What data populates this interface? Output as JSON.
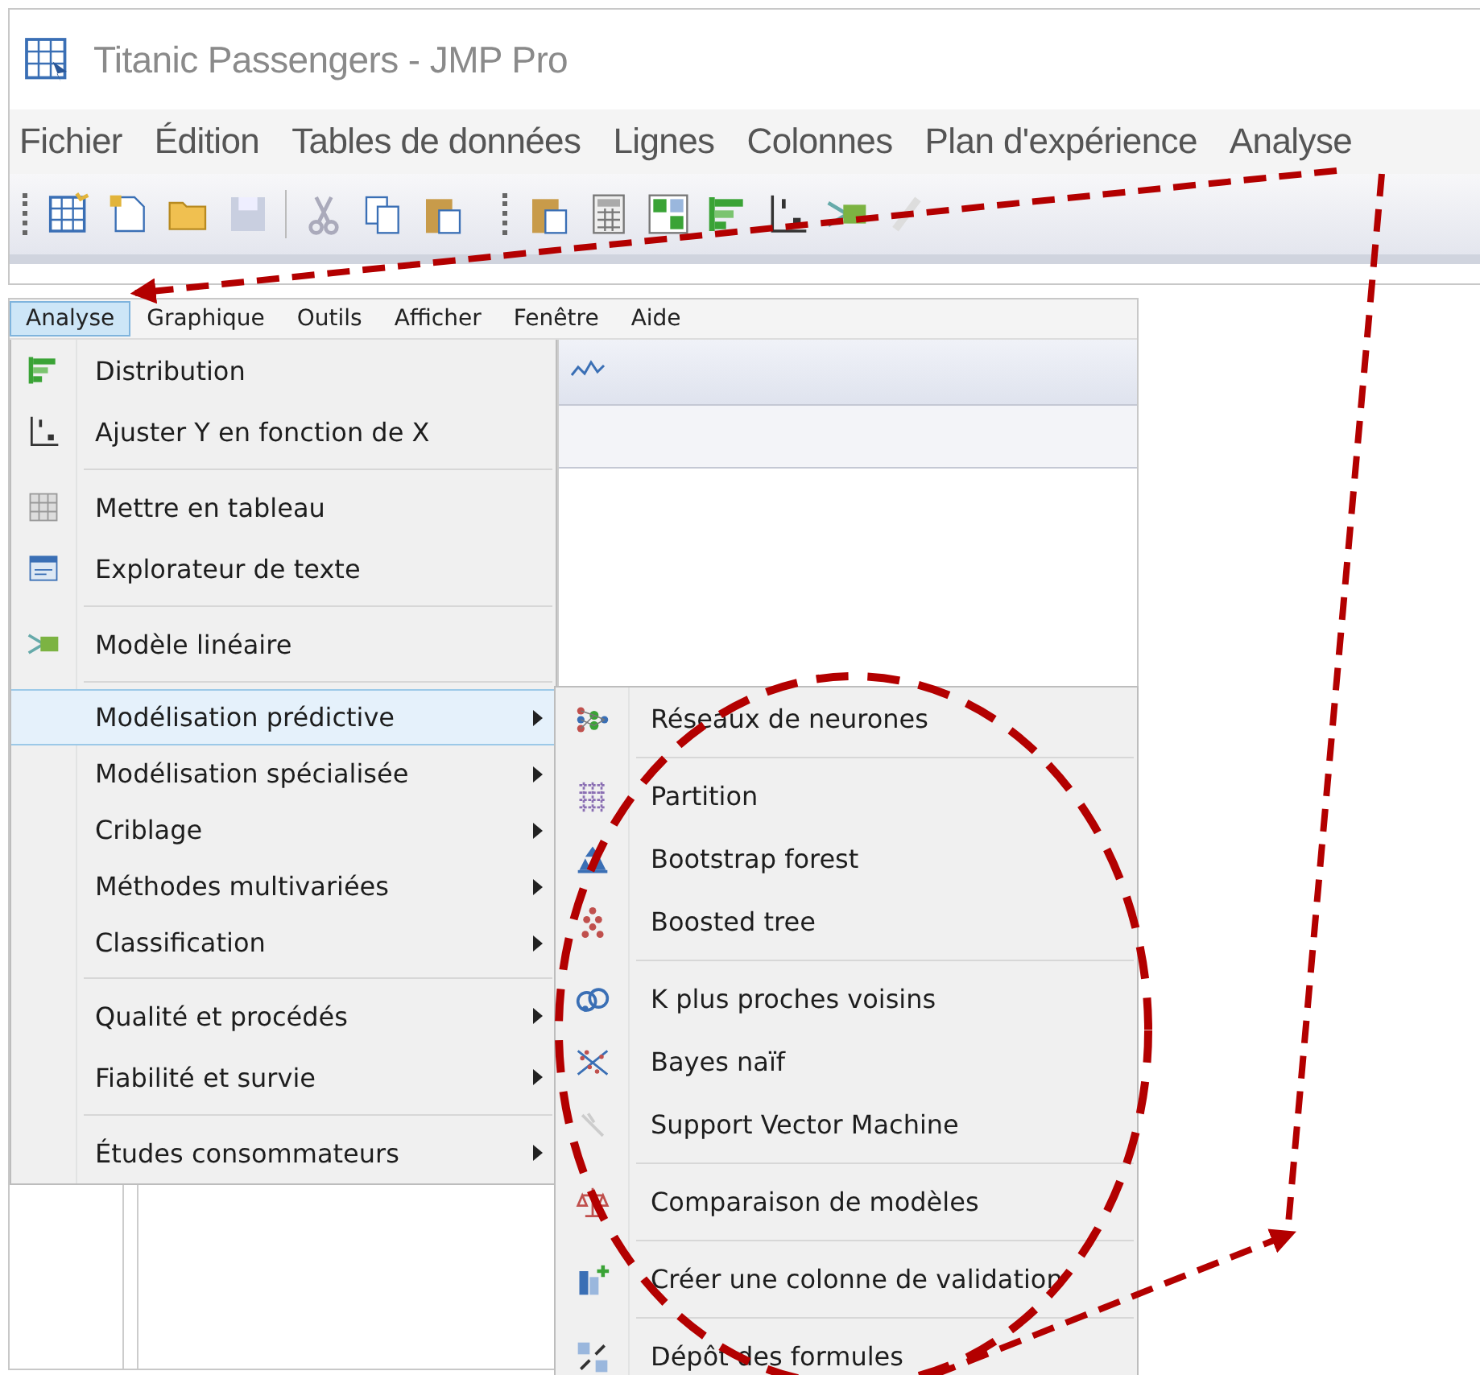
{
  "window": {
    "title": "Titanic Passengers - JMP Pro"
  },
  "menu_bar": [
    {
      "label": "Fichier"
    },
    {
      "label": "Édition"
    },
    {
      "label": "Tables de données"
    },
    {
      "label": "Lignes"
    },
    {
      "label": "Colonnes"
    },
    {
      "label": "Plan d'expérience"
    },
    {
      "label": "Analyse"
    }
  ],
  "data_window": {
    "menu_bar": [
      {
        "label": "Analyse",
        "selected": true
      },
      {
        "label": "Graphique",
        "selected": false
      },
      {
        "label": "Outils",
        "selected": false
      },
      {
        "label": "Afficher",
        "selected": false
      },
      {
        "label": "Fenêtre",
        "selected": false
      },
      {
        "label": "Aide",
        "selected": false
      }
    ]
  },
  "analyse_menu": {
    "groups": [
      [
        {
          "label": "Distribution",
          "has_submenu": false,
          "selected": false
        },
        {
          "label": "Ajuster Y en fonction de X",
          "has_submenu": false,
          "selected": false
        }
      ],
      [
        {
          "label": "Mettre en tableau",
          "has_submenu": false,
          "selected": false
        },
        {
          "label": "Explorateur de texte",
          "has_submenu": false,
          "selected": false
        }
      ],
      [
        {
          "label": "Modèle linéaire",
          "has_submenu": false,
          "selected": false
        }
      ],
      [
        {
          "label": "Modélisation prédictive",
          "has_submenu": true,
          "selected": true
        },
        {
          "label": "Modélisation spécialisée",
          "has_submenu": true,
          "selected": false
        },
        {
          "label": "Criblage",
          "has_submenu": true,
          "selected": false
        },
        {
          "label": "Méthodes multivariées",
          "has_submenu": true,
          "selected": false
        },
        {
          "label": "Classification",
          "has_submenu": true,
          "selected": false
        }
      ],
      [
        {
          "label": "Qualité et procédés",
          "has_submenu": true,
          "selected": false
        },
        {
          "label": "Fiabilité et survie",
          "has_submenu": true,
          "selected": false
        }
      ],
      [
        {
          "label": "Études consommateurs",
          "has_submenu": true,
          "selected": false
        }
      ]
    ]
  },
  "predictive_submenu": {
    "groups": [
      [
        {
          "label": "Réseaux de neurones"
        }
      ],
      [
        {
          "label": "Partition"
        },
        {
          "label": "Bootstrap forest"
        },
        {
          "label": "Boosted tree"
        }
      ],
      [
        {
          "label": "K plus proches voisins"
        },
        {
          "label": "Bayes naïf"
        },
        {
          "label": "Support Vector Machine"
        }
      ],
      [
        {
          "label": "Comparaison de modèles"
        }
      ],
      [
        {
          "label": "Créer une colonne de validation"
        }
      ],
      [
        {
          "label": "Dépôt des formules"
        }
      ]
    ]
  }
}
